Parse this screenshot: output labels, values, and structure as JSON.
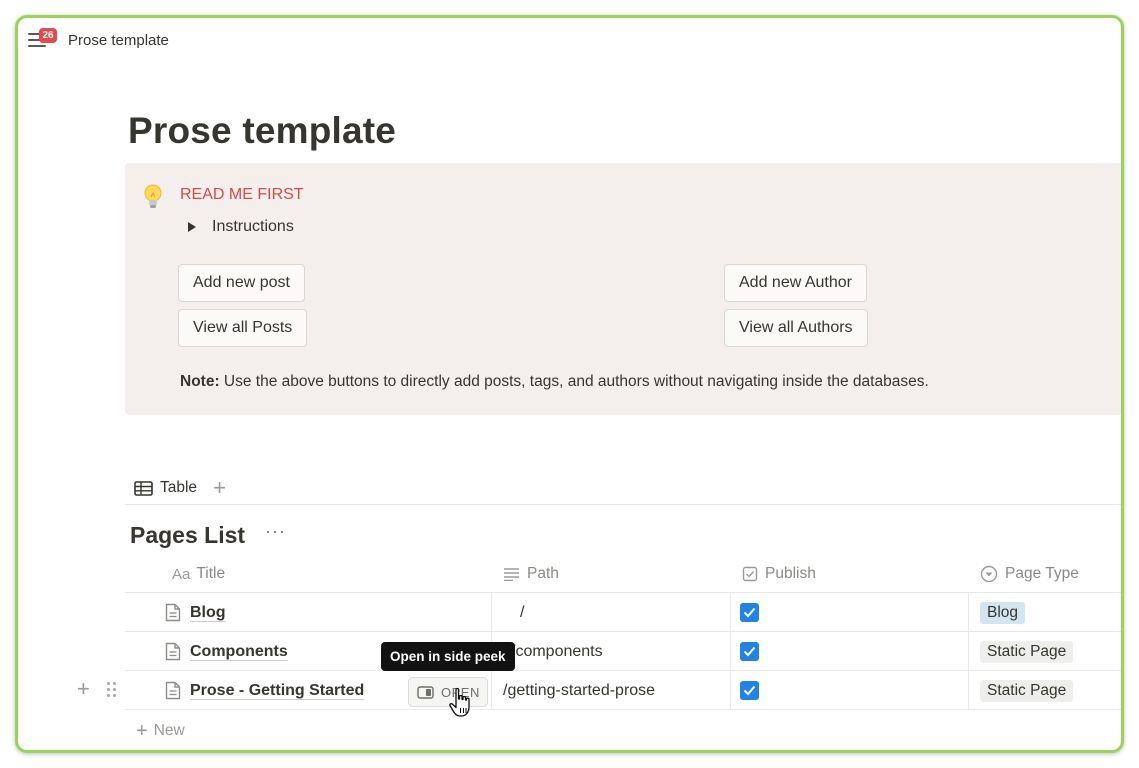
{
  "topbar": {
    "notification_count": "26",
    "breadcrumb": "Prose template"
  },
  "page": {
    "title": "Prose template"
  },
  "callout": {
    "icon": "lightbulb-icon",
    "heading": "READ ME FIRST",
    "toggle_label": "Instructions",
    "buttons": {
      "add_post": "Add new post",
      "view_posts": "View all Posts",
      "add_author": "Add new Author",
      "view_authors": "View all Authors"
    },
    "note_label": "Note:",
    "note_text": " Use the above buttons to directly add posts, tags, and authors without navigating inside the databases."
  },
  "views": {
    "active_tab": "Table"
  },
  "database": {
    "title": "Pages List",
    "more": "···",
    "columns": {
      "title_prefix": "Aa",
      "title": "Title",
      "path": "Path",
      "publish": "Publish",
      "page_type": "Page Type"
    },
    "rows": [
      {
        "title": "Blog",
        "path": "/",
        "publish": true,
        "page_type": "Blog"
      },
      {
        "title": "Components",
        "path": "/components",
        "publish": true,
        "page_type": "Static Page"
      },
      {
        "title": "Prose - Getting Started",
        "path": "/getting-started-prose",
        "publish": true,
        "page_type": "Static Page"
      }
    ],
    "new_row_label": "New",
    "open_button": "OPEN",
    "tooltip": "Open in side peek"
  },
  "colors": {
    "frame_border": "#9ad35a",
    "callout_bg": "#f4eeec",
    "readme_red": "#d44c47",
    "checkbox_blue": "#2383e2",
    "tag_blog": "#d3e5ef",
    "tag_static": "#eeeeec",
    "badge_red": "#e5484d"
  }
}
